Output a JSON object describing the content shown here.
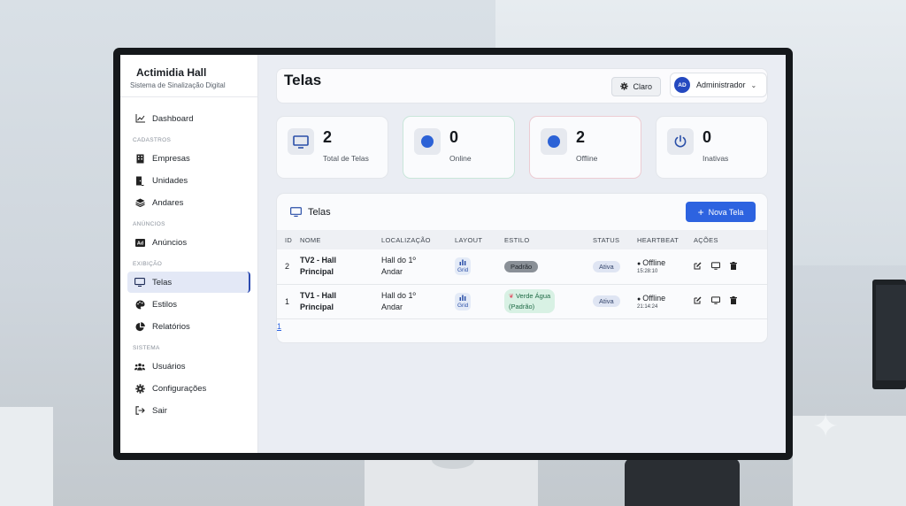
{
  "app": {
    "brand_title": "Actimidia Hall",
    "brand_subtitle": "Sistema de Sinalização Digital"
  },
  "sidebar": {
    "dashboard": "Dashboard",
    "sections": {
      "cadastros": "CADASTROS",
      "anuncios": "ANÚNCIOS",
      "exibicao": "EXIBIÇÃO",
      "sistema": "SISTEMA"
    },
    "items": {
      "empresas": "Empresas",
      "unidades": "Unidades",
      "andares": "Andares",
      "anuncios": "Anúncios",
      "telas": "Telas",
      "estilos": "Estilos",
      "relatorios": "Relatórios",
      "usuarios": "Usuários",
      "configuracoes": "Configurações",
      "sair": "Sair"
    },
    "active_item": "telas"
  },
  "header": {
    "title": "Telas",
    "theme_label": "Claro",
    "user_initials": "AD",
    "user_name": "Administrador"
  },
  "stats": [
    {
      "value": "2",
      "label": "Total de Telas",
      "icon": "monitor-icon"
    },
    {
      "value": "0",
      "label": "Online",
      "icon": "blue-dot-icon"
    },
    {
      "value": "2",
      "label": "Offline",
      "icon": "blue-dot-icon"
    },
    {
      "value": "0",
      "label": "Inativas",
      "icon": "power-icon"
    }
  ],
  "table_card": {
    "title": "Telas",
    "new_button": "Nova Tela",
    "columns": {
      "id": "ID",
      "nome": "NOME",
      "localizacao": "LOCALIZAÇÃO",
      "layout": "LAYOUT",
      "estilo": "ESTILO",
      "status": "STATUS",
      "heartbeat": "HEARTBEAT",
      "acoes": "AÇÕES"
    },
    "rows": [
      {
        "id": "2",
        "nome_1": "TV2 - Hall",
        "nome_2": "Principal",
        "loc_1": "Hall do 1º",
        "loc_2": "Andar",
        "layout": "Grid",
        "estilo": "Padrão",
        "status": "Ativa",
        "heartbeat": "Offline",
        "heartbeat_time": "15:28:10"
      },
      {
        "id": "1",
        "nome_1": "TV1 - Hall",
        "nome_2": "Principal",
        "loc_1": "Hall do 1º",
        "loc_2": "Andar",
        "layout": "Grid",
        "estilo_1": "Verde Água",
        "estilo_2": "(Padrão)",
        "status": "Ativa",
        "heartbeat": "Offline",
        "heartbeat_time": "21:14:24"
      }
    ],
    "page": "1"
  },
  "colors": {
    "accent": "#2d63e0",
    "avatar": "#2449c0",
    "online_border": "#c9e6da",
    "offline_border": "#ecccd3"
  }
}
